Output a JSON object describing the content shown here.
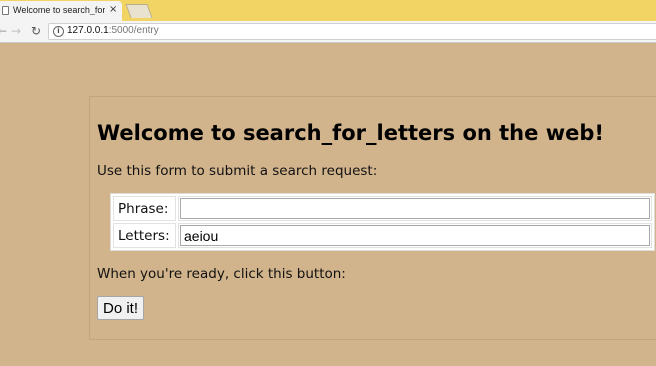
{
  "browser": {
    "tab_title": "Welcome to search_for_",
    "tab_close": "×",
    "url_host": "127.0.0.1",
    "url_path": ":5000/entry"
  },
  "page": {
    "heading": "Welcome to search_for_letters on the web!",
    "intro": "Use this form to submit a search request:",
    "form": {
      "phrase_label": "Phrase:",
      "phrase_value": "",
      "letters_label": "Letters:",
      "letters_value": "aeiou"
    },
    "ready_text": "When you're ready, click this button:",
    "submit_label": "Do it!"
  },
  "colors": {
    "page_background": "#d2b48c",
    "tabbar_background": "#f2d464"
  }
}
